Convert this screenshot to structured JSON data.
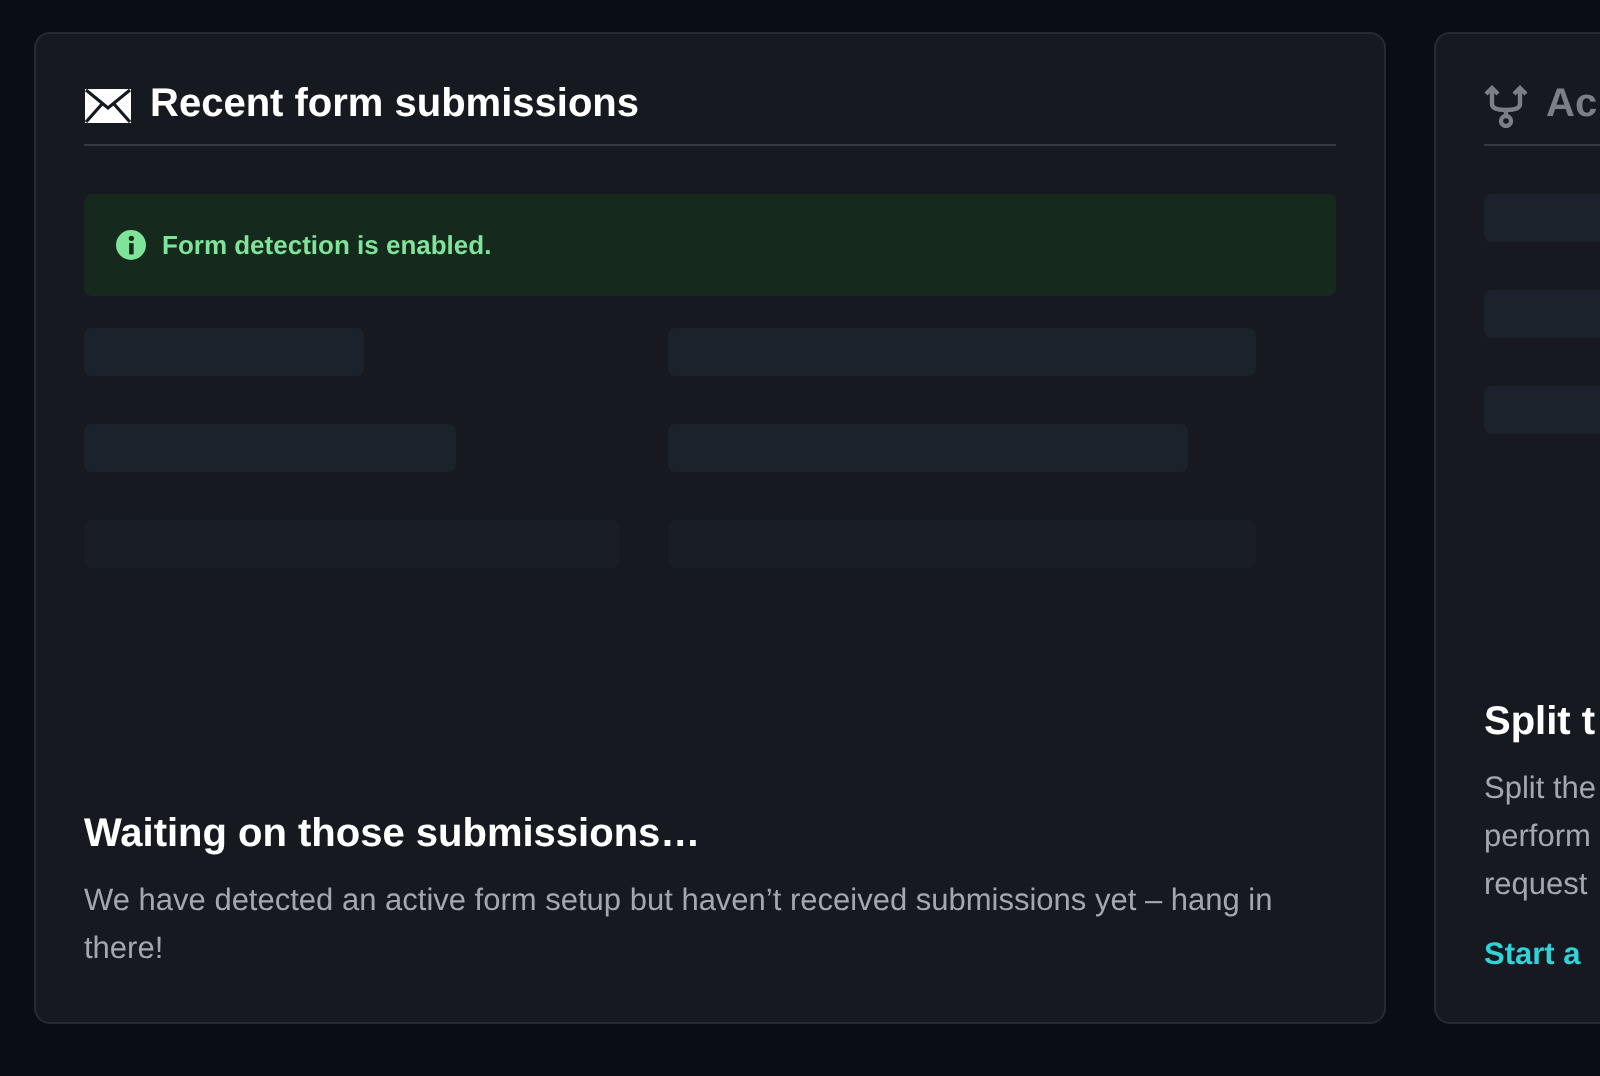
{
  "cards": [
    {
      "title": "Recent form submissions",
      "kind": "mail",
      "notice": {
        "kind": "success",
        "text": "Form detection is enabled."
      },
      "empty_title": "Waiting on those submissions…",
      "empty_text": "We have detected an active form setup but haven’t received submissions yet – hang in there!"
    },
    {
      "title": "Ac",
      "kind": "split",
      "empty_title": "Split t",
      "empty_lines": [
        "Split the",
        "perform",
        "request"
      ],
      "link": "Start a"
    }
  ]
}
